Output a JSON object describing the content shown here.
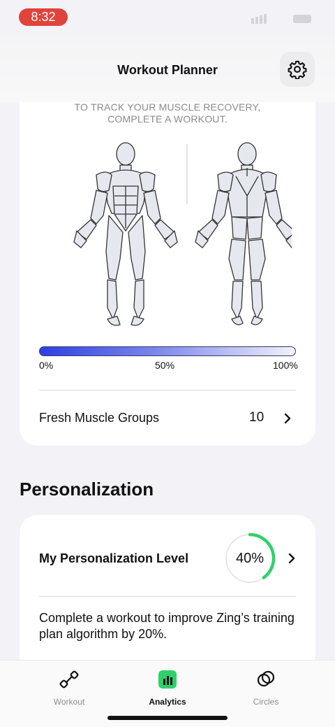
{
  "status_bar": {
    "time": "8:32"
  },
  "header": {
    "title": "Workout Planner",
    "settings_icon": "gear-icon"
  },
  "recovery": {
    "hint": "TO TRACK YOUR MUSCLE RECOVERY, COMPLETE A WORKOUT.",
    "scale_labels": [
      "0%",
      "50%",
      "100%"
    ],
    "gradient_colors": [
      "#2e3fe4",
      "#7a86ee",
      "#f2f2fb"
    ],
    "fresh_groups": {
      "label": "Fresh Muscle Groups",
      "value": "10"
    }
  },
  "personalization": {
    "section_title": "Personalization",
    "label": "My Personalization Level",
    "percent_text": "40%",
    "level_fraction": 0.4,
    "ring_color": "#2fd06a",
    "description": "Complete a workout to improve Zing’s training plan algorithm by 20%."
  },
  "tabs": [
    {
      "label": "Workout",
      "icon": "dumbbell-icon",
      "active": false
    },
    {
      "label": "Analytics",
      "icon": "analytics-icon",
      "active": true
    },
    {
      "label": "Circles",
      "icon": "circles-icon",
      "active": false
    }
  ]
}
